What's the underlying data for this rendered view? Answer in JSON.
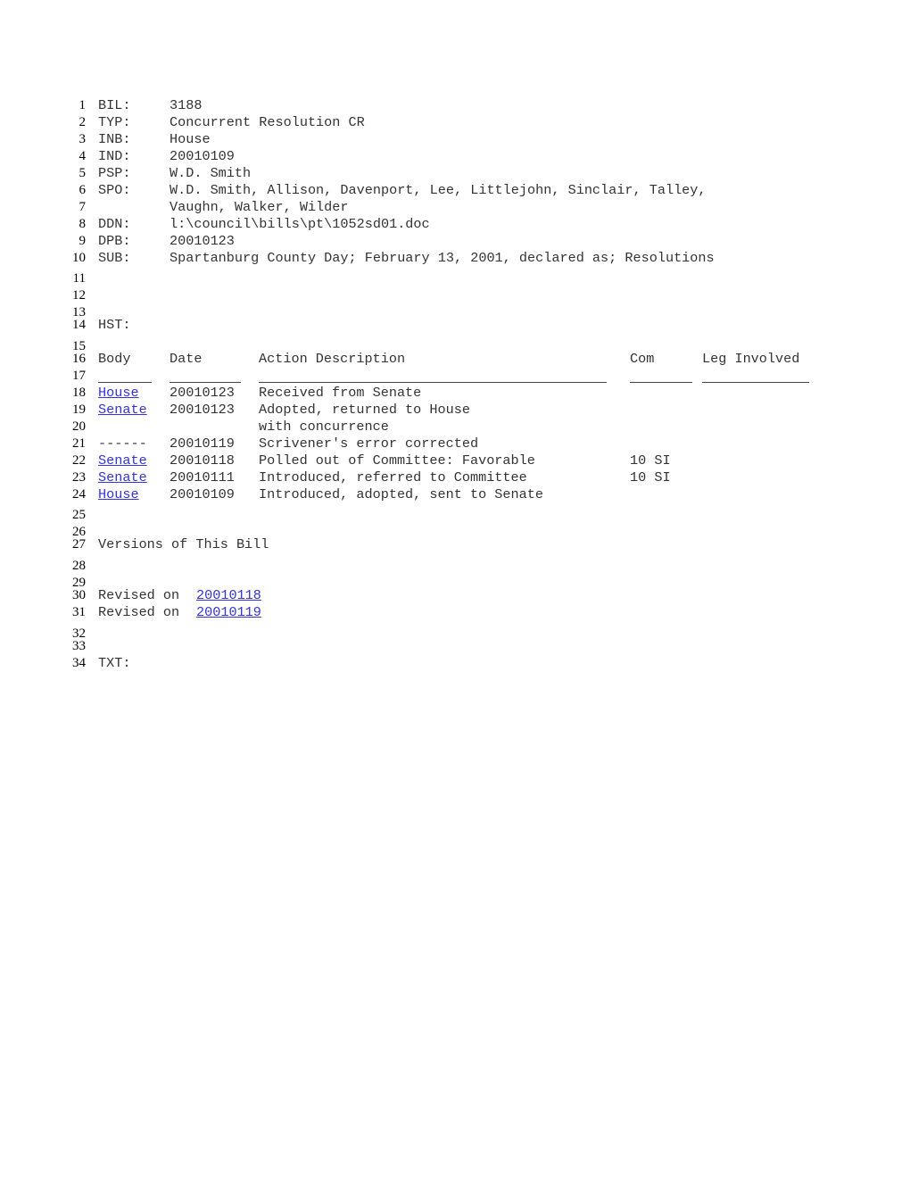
{
  "line_numbers": [
    "1",
    "2",
    "3",
    "4",
    "5",
    "6",
    "7",
    "8",
    "9",
    "10",
    "11",
    "12",
    "13",
    "14",
    "15",
    "16",
    "17",
    "18",
    "19",
    "20",
    "21",
    "22",
    "23",
    "24",
    "25",
    "26",
    "27",
    "28",
    "29",
    "30",
    "31",
    "32",
    "33",
    "34"
  ],
  "fields": [
    {
      "key": "BIL:",
      "value": "3188"
    },
    {
      "key": "TYP:",
      "value": "Concurrent Resolution CR"
    },
    {
      "key": "INB:",
      "value": "House"
    },
    {
      "key": "IND:",
      "value": "20010109"
    },
    {
      "key": "PSP:",
      "value": "W.D. Smith"
    },
    {
      "key": "SPO:",
      "value": "W.D. Smith, Allison, Davenport, Lee, Littlejohn, Sinclair, Talley,"
    },
    {
      "key": "",
      "value": "Vaughn, Walker, Wilder"
    },
    {
      "key": "DDN:",
      "value": "l:\\council\\bills\\pt\\1052sd01.doc"
    },
    {
      "key": "DPB:",
      "value": "20010123"
    },
    {
      "key": "SUB:",
      "value": "Spartanburg County Day; February 13, 2001, declared as; Resolutions"
    }
  ],
  "history": {
    "label": "HST:",
    "headers": {
      "body": "Body",
      "date": "Date",
      "action": "Action Description",
      "com": "Com",
      "leg": "Leg Involved"
    },
    "rows": [
      {
        "body": "House",
        "body_link": true,
        "date": "20010123",
        "action": "Received from Senate",
        "com": ""
      },
      {
        "body": "Senate",
        "body_link": true,
        "date": "20010123",
        "action": "Adopted, returned to House",
        "com": ""
      },
      {
        "body": "",
        "body_link": false,
        "date": "",
        "action": "with concurrence",
        "com": ""
      },
      {
        "body": "------",
        "body_link": false,
        "date": "20010119",
        "action": "Scrivener's error corrected",
        "com": ""
      },
      {
        "body": "Senate",
        "body_link": true,
        "date": "20010118",
        "action": "Polled out of Committee: Favorable",
        "com": "10 SI"
      },
      {
        "body": "Senate",
        "body_link": true,
        "date": "20010111",
        "action": "Introduced, referred to Committee",
        "com": "10 SI"
      },
      {
        "body": "House",
        "body_link": true,
        "date": "20010109",
        "action": "Introduced, adopted, sent to Senate",
        "com": ""
      }
    ]
  },
  "versions": {
    "title": "Versions of This Bill",
    "items": [
      {
        "prefix": "Revised on ",
        "link": "20010118"
      },
      {
        "prefix": "Revised on ",
        "link": "20010119"
      }
    ]
  },
  "text_label": "TXT:",
  "colors": {
    "link": "#3333dd",
    "text": "#333333"
  }
}
